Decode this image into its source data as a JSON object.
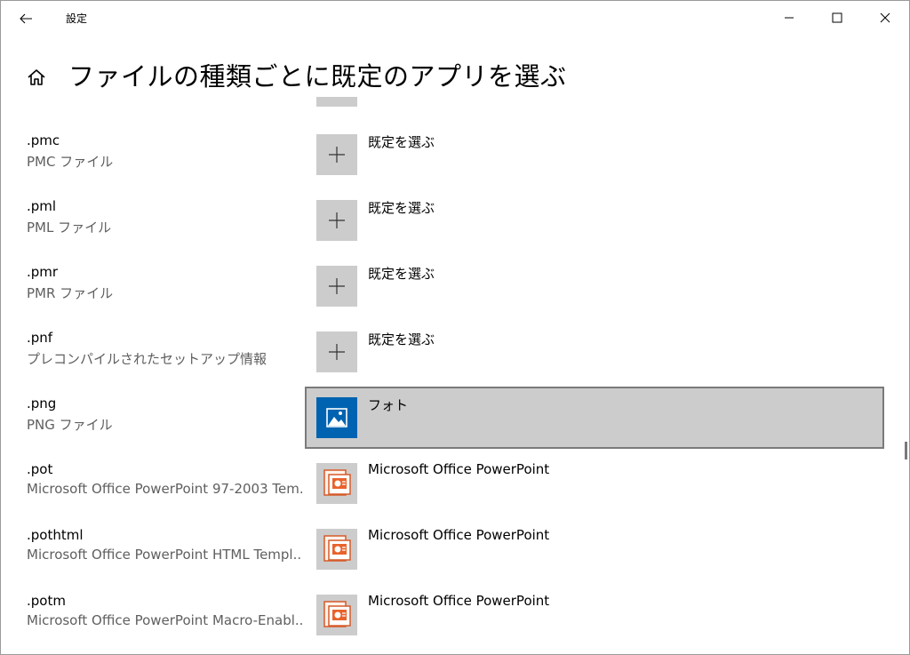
{
  "window": {
    "app_title": "設定",
    "back_icon": "back-arrow-icon",
    "minimize_icon": "minimize-icon",
    "maximize_icon": "maximize-icon",
    "close_icon": "close-icon"
  },
  "header": {
    "home_icon": "home-icon",
    "title": "ファイルの種類ごとに既定のアプリを選ぶ"
  },
  "rows": [
    {
      "ext": ".pmc",
      "desc": "PMC ファイル",
      "app": "既定を選ぶ",
      "icon": "plus-icon"
    },
    {
      "ext": ".pml",
      "desc": "PML ファイル",
      "app": "既定を選ぶ",
      "icon": "plus-icon"
    },
    {
      "ext": ".pmr",
      "desc": "PMR ファイル",
      "app": "既定を選ぶ",
      "icon": "plus-icon"
    },
    {
      "ext": ".pnf",
      "desc": "プレコンパイルされたセットアップ情報",
      "app": "既定を選ぶ",
      "icon": "plus-icon"
    },
    {
      "ext": ".png",
      "desc": "PNG ファイル",
      "app": "フォト",
      "icon": "photos-app-icon"
    },
    {
      "ext": ".pot",
      "desc": "Microsoft Office PowerPoint 97-2003 Tem...",
      "app": "Microsoft Office PowerPoint",
      "icon": "powerpoint-icon"
    },
    {
      "ext": ".pothtml",
      "desc": "Microsoft Office PowerPoint HTML Templ...",
      "app": "Microsoft Office PowerPoint",
      "icon": "powerpoint-icon"
    },
    {
      "ext": ".potm",
      "desc": "Microsoft Office PowerPoint Macro-Enabl...",
      "app": "Microsoft Office PowerPoint",
      "icon": "powerpoint-icon"
    }
  ],
  "colors": {
    "tile_gray": "#cccccc",
    "photos_blue": "#0063b1",
    "selected_border": "#7a7a7a",
    "desc_text": "#5f5f5f"
  }
}
